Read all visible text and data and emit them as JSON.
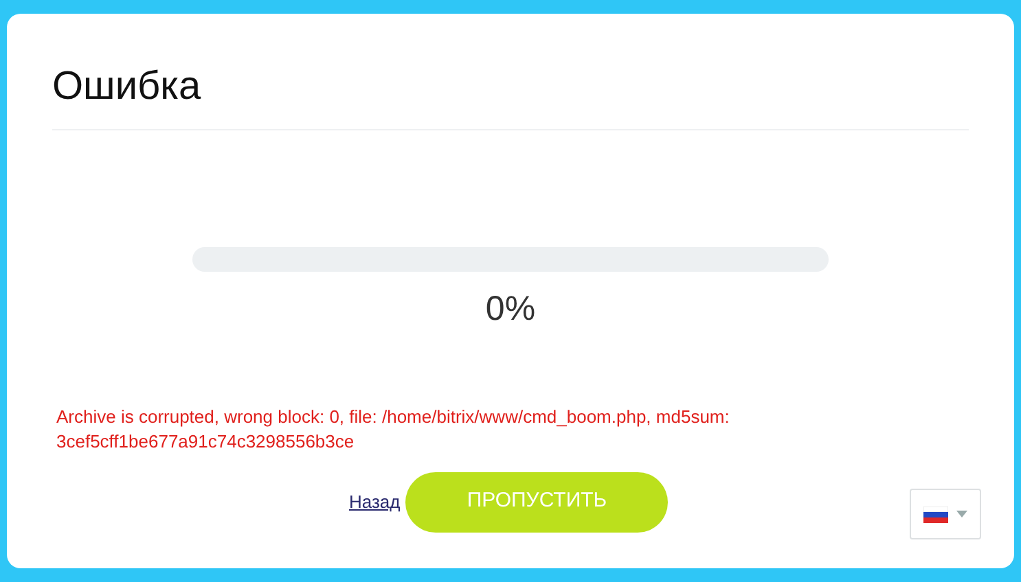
{
  "title": "Ошибка",
  "progress": {
    "level": 0,
    "reading": "0%"
  },
  "error": "Archive is corrupted, wrong block: 0, file: /home/bitrix/www/cmd_boom.php, md5sum: 3cef5cff1be677a91c74c3298556b3ce",
  "back_link": "Назад",
  "skip_button": "ПРОПУСТИТЬ"
}
